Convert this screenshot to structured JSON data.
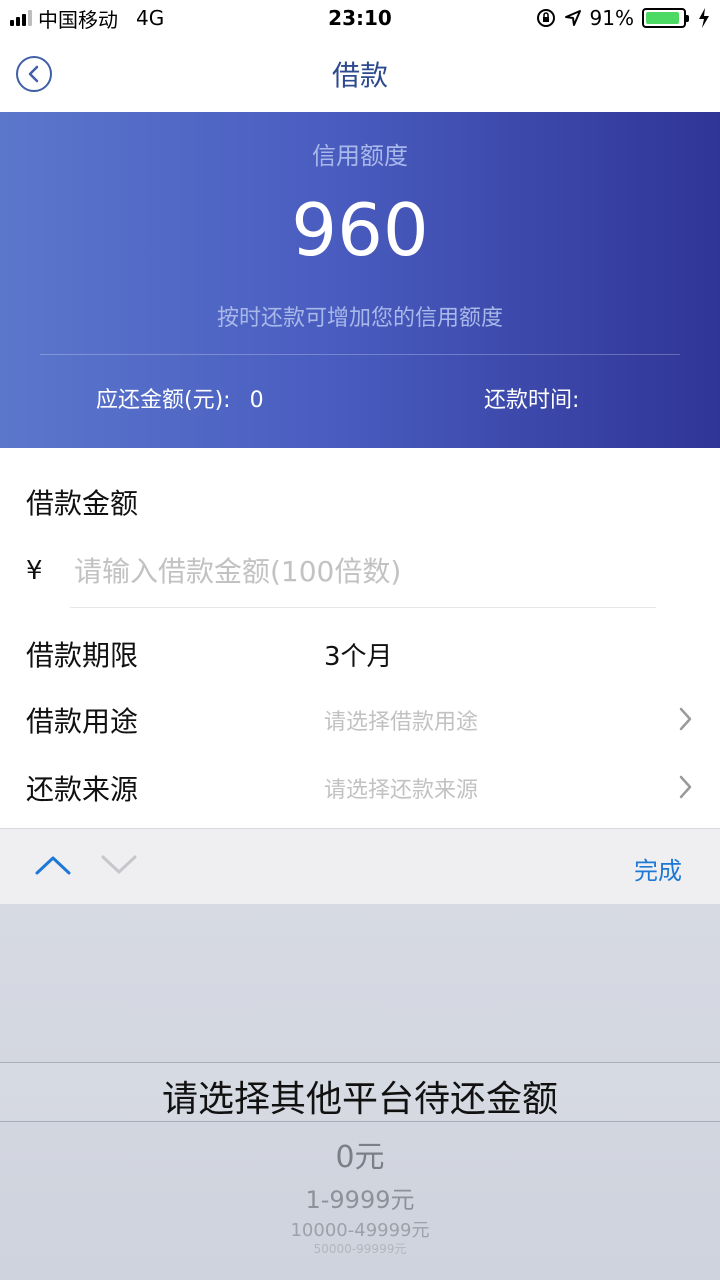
{
  "status_bar": {
    "carrier": "中国移动",
    "network": "4G",
    "time": "23:10",
    "battery": "91%",
    "icons": [
      "orientation-lock-icon",
      "location-arrow-icon",
      "battery-icon",
      "charging-bolt-icon"
    ]
  },
  "nav": {
    "title": "借款",
    "back_icon": "chevron-left-icon"
  },
  "banner": {
    "label": "信用额度",
    "amount": "960",
    "tip": "按时还款可增加您的信用额度",
    "due_label": "应还金额(元):",
    "due_value": "0",
    "repay_time_label": "还款时间:"
  },
  "form": {
    "amount_title": "借款金额",
    "currency_symbol": "¥",
    "amount_placeholder": "请输入借款金额(100倍数)",
    "term_label": "借款期限",
    "term_value": "3个月",
    "purpose_label": "借款用途",
    "purpose_placeholder": "请选择借款用途",
    "source_label": "还款来源",
    "source_placeholder": "请选择还款来源"
  },
  "accessory": {
    "done_label": "完成"
  },
  "picker": {
    "selected": "请选择其他平台待还金额",
    "options": [
      "0元",
      "1-9999元",
      "10000-49999元",
      "50000-99999元"
    ]
  },
  "colors": {
    "accent_blue": "#1e78d6",
    "banner_start": "#5b77cc",
    "banner_end": "#2f3596",
    "title_blue": "#2d4a8f"
  }
}
